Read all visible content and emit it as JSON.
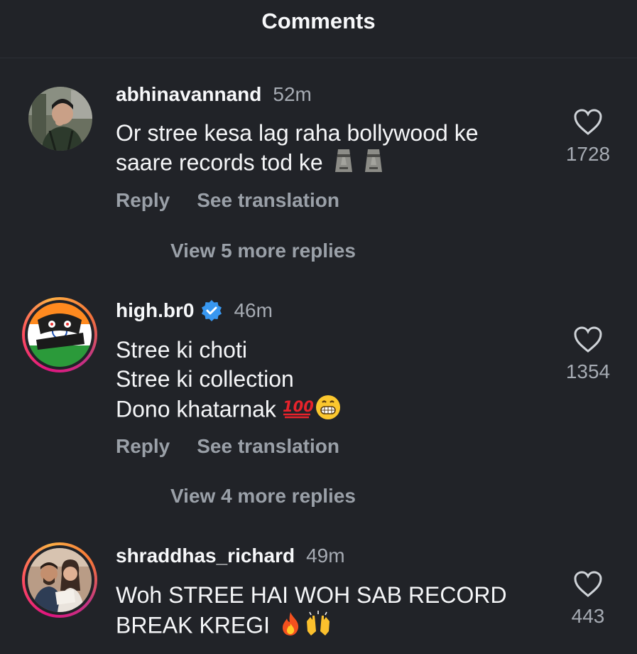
{
  "header": {
    "title": "Comments"
  },
  "comments": [
    {
      "username": "abhinavannand",
      "time": "52m",
      "lines": [
        "Or stree kesa lag raha bollywood ke",
        "saare records tod ke"
      ],
      "emojis": [
        "moai-emoji",
        "moai-emoji"
      ],
      "reply_label": "Reply",
      "translate_label": "See translation",
      "view_replies": "View 5 more replies",
      "likes": "1728",
      "verified": false
    },
    {
      "username": "high.br0",
      "time": "46m",
      "lines": [
        "Stree ki choti",
        "Stree ki collection",
        "Dono khatarnak"
      ],
      "emojis": [
        "hundred-points-emoji",
        "grinning-face-emoji"
      ],
      "reply_label": "Reply",
      "translate_label": "See translation",
      "view_replies": "View 4 more replies",
      "likes": "1354",
      "verified": true,
      "avatar_text": "HIGH BRO"
    },
    {
      "username": "shraddhas_richard",
      "time": "49m",
      "lines": [
        "Woh STREE HAI WOH SAB RECORD",
        "BREAK KREGI"
      ],
      "emojis": [
        "fire-emoji",
        "raising-hands-emoji"
      ],
      "likes": "443",
      "verified": false
    }
  ],
  "colors": {
    "background": "#212328",
    "verified_badge": "#3897f0",
    "muted_text": "#9aa0a8",
    "story_ring": "#e0157f"
  }
}
